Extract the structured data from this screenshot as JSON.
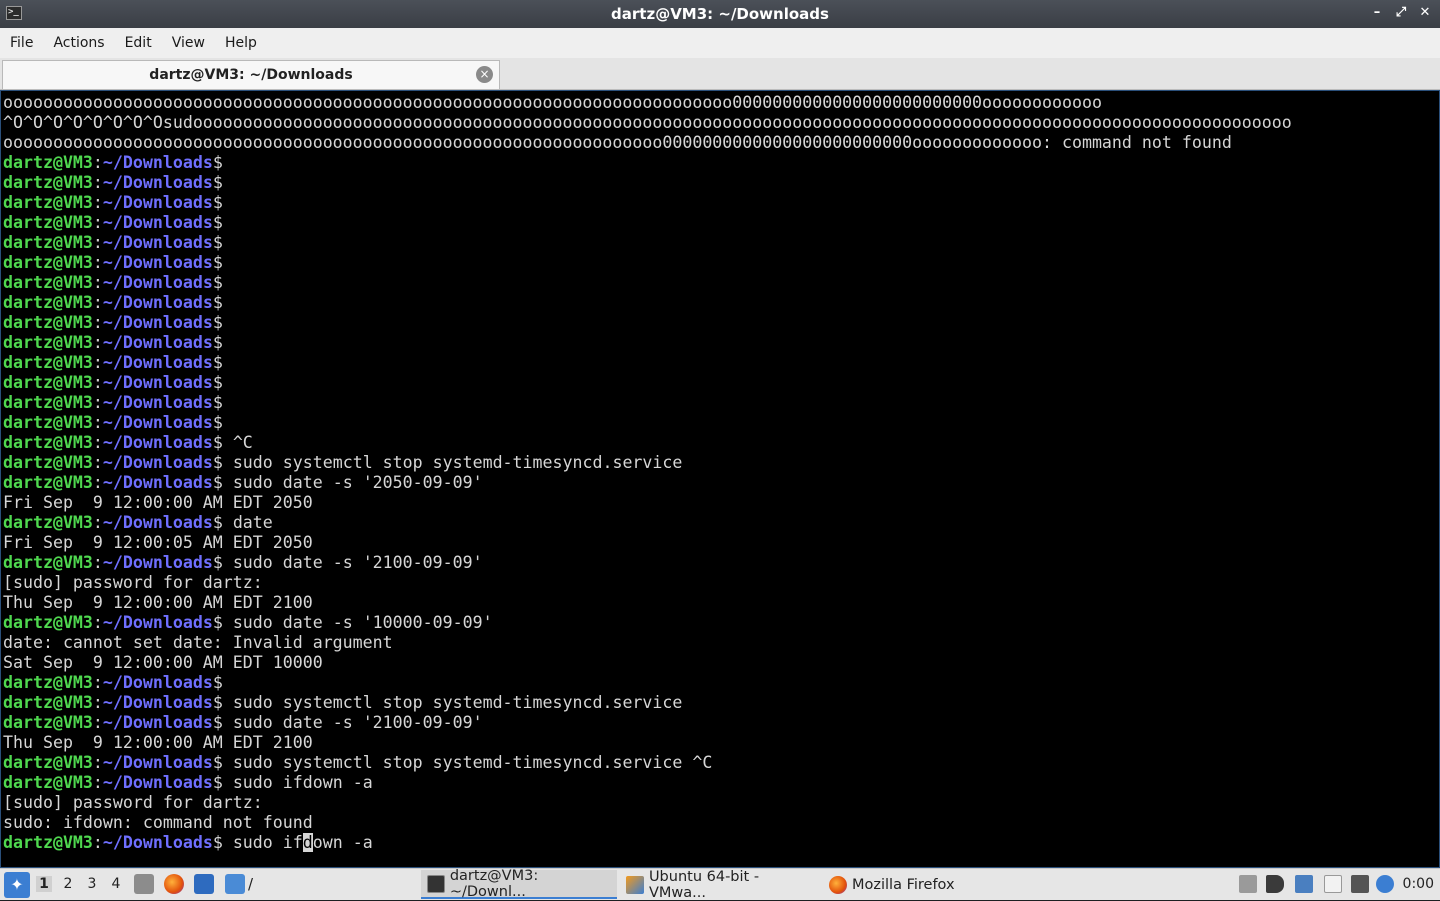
{
  "window": {
    "title": "dartz@VM3: ~/Downloads",
    "controls": [
      "–",
      "⤢",
      "✕"
    ]
  },
  "menubar": {
    "items": [
      "File",
      "Actions",
      "Edit",
      "View",
      "Help"
    ]
  },
  "tabs": [
    {
      "label": "dartz@VM3: ~/Downloads",
      "close_icon": "×"
    }
  ],
  "prompt": {
    "user": "dartz@VM3",
    "colon": ":",
    "path": "~/Downloads",
    "dollar": "$"
  },
  "terminal": {
    "lines": [
      {
        "text": "ooooooooooooooooooooooooooooooooooooooooooooooooooooooooooooooooooooooooo0000000000000000000000000oooooooooooo"
      },
      {
        "text": "^O^O^O^O^O^O^O^Osudoooooooooooooooooooooooooooooooooooooooooooooooooooooooooooooooooooooooooooooooooooooooooooooooooooooooooooooo"
      },
      {
        "text": "oooooooooooooooooooooooooooooooooooooooooooooooooooooooooooooooooo0000000000000000000000000ooooooooooooo: command not found"
      },
      {
        "prompt": true,
        "cmd": ""
      },
      {
        "prompt": true,
        "cmd": ""
      },
      {
        "prompt": true,
        "cmd": ""
      },
      {
        "prompt": true,
        "cmd": ""
      },
      {
        "prompt": true,
        "cmd": ""
      },
      {
        "prompt": true,
        "cmd": ""
      },
      {
        "prompt": true,
        "cmd": ""
      },
      {
        "prompt": true,
        "cmd": ""
      },
      {
        "prompt": true,
        "cmd": ""
      },
      {
        "prompt": true,
        "cmd": ""
      },
      {
        "prompt": true,
        "cmd": ""
      },
      {
        "prompt": true,
        "cmd": ""
      },
      {
        "prompt": true,
        "cmd": ""
      },
      {
        "prompt": true,
        "cmd": ""
      },
      {
        "prompt": true,
        "cmd": " ^C"
      },
      {
        "prompt": true,
        "cmd": " sudo systemctl stop systemd-timesyncd.service"
      },
      {
        "prompt": true,
        "cmd": " sudo date -s '2050-09-09'"
      },
      {
        "text": "Fri Sep  9 12:00:00 AM EDT 2050"
      },
      {
        "prompt": true,
        "cmd": " date"
      },
      {
        "text": "Fri Sep  9 12:00:05 AM EDT 2050"
      },
      {
        "prompt": true,
        "cmd": " sudo date -s '2100-09-09'"
      },
      {
        "text": "[sudo] password for dartz:"
      },
      {
        "text": "Thu Sep  9 12:00:00 AM EDT 2100"
      },
      {
        "prompt": true,
        "cmd": " sudo date -s '10000-09-09'"
      },
      {
        "text": "date: cannot set date: Invalid argument"
      },
      {
        "text": "Sat Sep  9 12:00:00 AM EDT 10000"
      },
      {
        "prompt": true,
        "cmd": ""
      },
      {
        "prompt": true,
        "cmd": " sudo systemctl stop systemd-timesyncd.service"
      },
      {
        "prompt": true,
        "cmd": " sudo date -s '2100-09-09'"
      },
      {
        "text": "Thu Sep  9 12:00:00 AM EDT 2100"
      },
      {
        "prompt": true,
        "cmd": " sudo systemctl stop systemd-timesyncd.service ^C"
      },
      {
        "prompt": true,
        "cmd": " sudo ifdown -a"
      },
      {
        "text": "[sudo] password for dartz:"
      },
      {
        "text": "sudo: ifdown: command not found"
      },
      {
        "prompt": true,
        "cmd": " sudo if",
        "cursor_char": "d",
        "cmd_after": "own -a"
      }
    ]
  },
  "taskbar": {
    "start_icon": "lubuntu-start-icon",
    "desktops": [
      "1",
      "2",
      "3",
      "4"
    ],
    "active_desktop": "1",
    "quicklaunch_slash": "/",
    "tasks": [
      {
        "label": "dartz@VM3: ~/Downl...",
        "icon": "terminal-icon",
        "active": true
      },
      {
        "label": "Ubuntu 64-bit - VMwa...",
        "icon": "vmware-icon",
        "active": false
      },
      {
        "label": "Mozilla Firefox",
        "icon": "firefox-icon",
        "active": false
      }
    ],
    "tray_icons": [
      "keyboard-icon",
      "volume-icon",
      "network-icon",
      "clipboard-icon",
      "display-icon",
      "update-notifier-icon"
    ],
    "clock": "0:00"
  }
}
